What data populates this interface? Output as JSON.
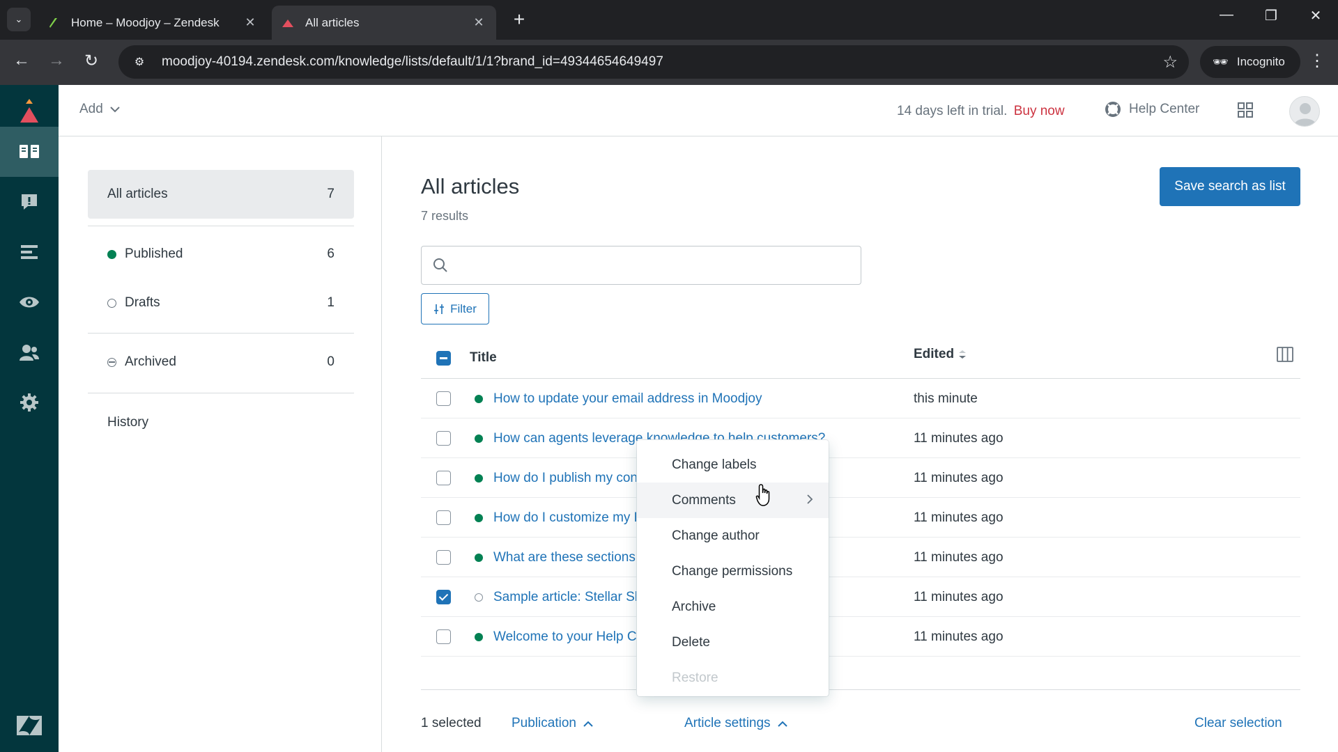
{
  "browser": {
    "tabs": [
      {
        "title": "Home – Moodjoy – Zendesk",
        "active": false
      },
      {
        "title": "All articles",
        "active": true
      }
    ],
    "url": "moodjoy-40194.zendesk.com/knowledge/lists/default/1/1?brand_id=49344654649497",
    "incognito_label": "Incognito"
  },
  "header": {
    "add_label": "Add",
    "trial_text": "14 days left in trial.",
    "buy_now": "Buy now",
    "help_center": "Help Center"
  },
  "rail": {
    "items": [
      "knowledge-icon",
      "alert-icon",
      "list-icon",
      "eye-icon",
      "users-icon",
      "gear-icon"
    ],
    "active": "knowledge-icon",
    "colors": {
      "bg": "#03363d",
      "active": "#2f5d63",
      "brand": "#f79a3e"
    }
  },
  "subnav": {
    "all": {
      "label": "All articles",
      "count": "7"
    },
    "published": {
      "label": "Published",
      "count": "6"
    },
    "drafts": {
      "label": "Drafts",
      "count": "1"
    },
    "archived": {
      "label": "Archived",
      "count": "0"
    },
    "history": "History"
  },
  "main": {
    "title": "All articles",
    "results": "7 results",
    "save_button": "Save search as list",
    "search_placeholder": "",
    "filter_label": "Filter",
    "columns": {
      "title": "Title",
      "edited": "Edited"
    },
    "rows": [
      {
        "title": "How to update your email address in Moodjoy",
        "edited": "this minute",
        "status": "published",
        "checked": false
      },
      {
        "title": "How can agents leverage knowledge to help customers?",
        "edited": "11 minutes ago",
        "status": "published",
        "checked": false
      },
      {
        "title": "How do I publish my content in other languages?",
        "edited": "11 minutes ago",
        "status": "published",
        "checked": false
      },
      {
        "title": "How do I customize my Help Center?",
        "edited": "11 minutes ago",
        "status": "published",
        "checked": false
      },
      {
        "title": "What are these sections and articles doing here?",
        "edited": "11 minutes ago",
        "status": "published",
        "checked": false
      },
      {
        "title": "Sample article: Stellar Skyonomy refund policies",
        "edited": "11 minutes ago",
        "status": "draft",
        "checked": true
      },
      {
        "title": "Welcome to your Help Center!",
        "edited": "11 minutes ago",
        "status": "published",
        "checked": false
      }
    ],
    "bottom": {
      "selected": "1 selected",
      "publication": "Publication",
      "article_settings": "Article settings",
      "clear_selection": "Clear selection"
    }
  },
  "context_menu": {
    "items": [
      {
        "label": "Change labels",
        "state": "normal"
      },
      {
        "label": "Comments",
        "state": "hover",
        "submenu": true
      },
      {
        "label": "Change author",
        "state": "normal"
      },
      {
        "label": "Change permissions",
        "state": "normal"
      },
      {
        "label": "Archive",
        "state": "normal"
      },
      {
        "label": "Delete",
        "state": "normal"
      },
      {
        "label": "Restore",
        "state": "disabled"
      }
    ]
  },
  "colors": {
    "primary": "#1f73b7",
    "published": "#038153",
    "danger": "#cc3340"
  }
}
